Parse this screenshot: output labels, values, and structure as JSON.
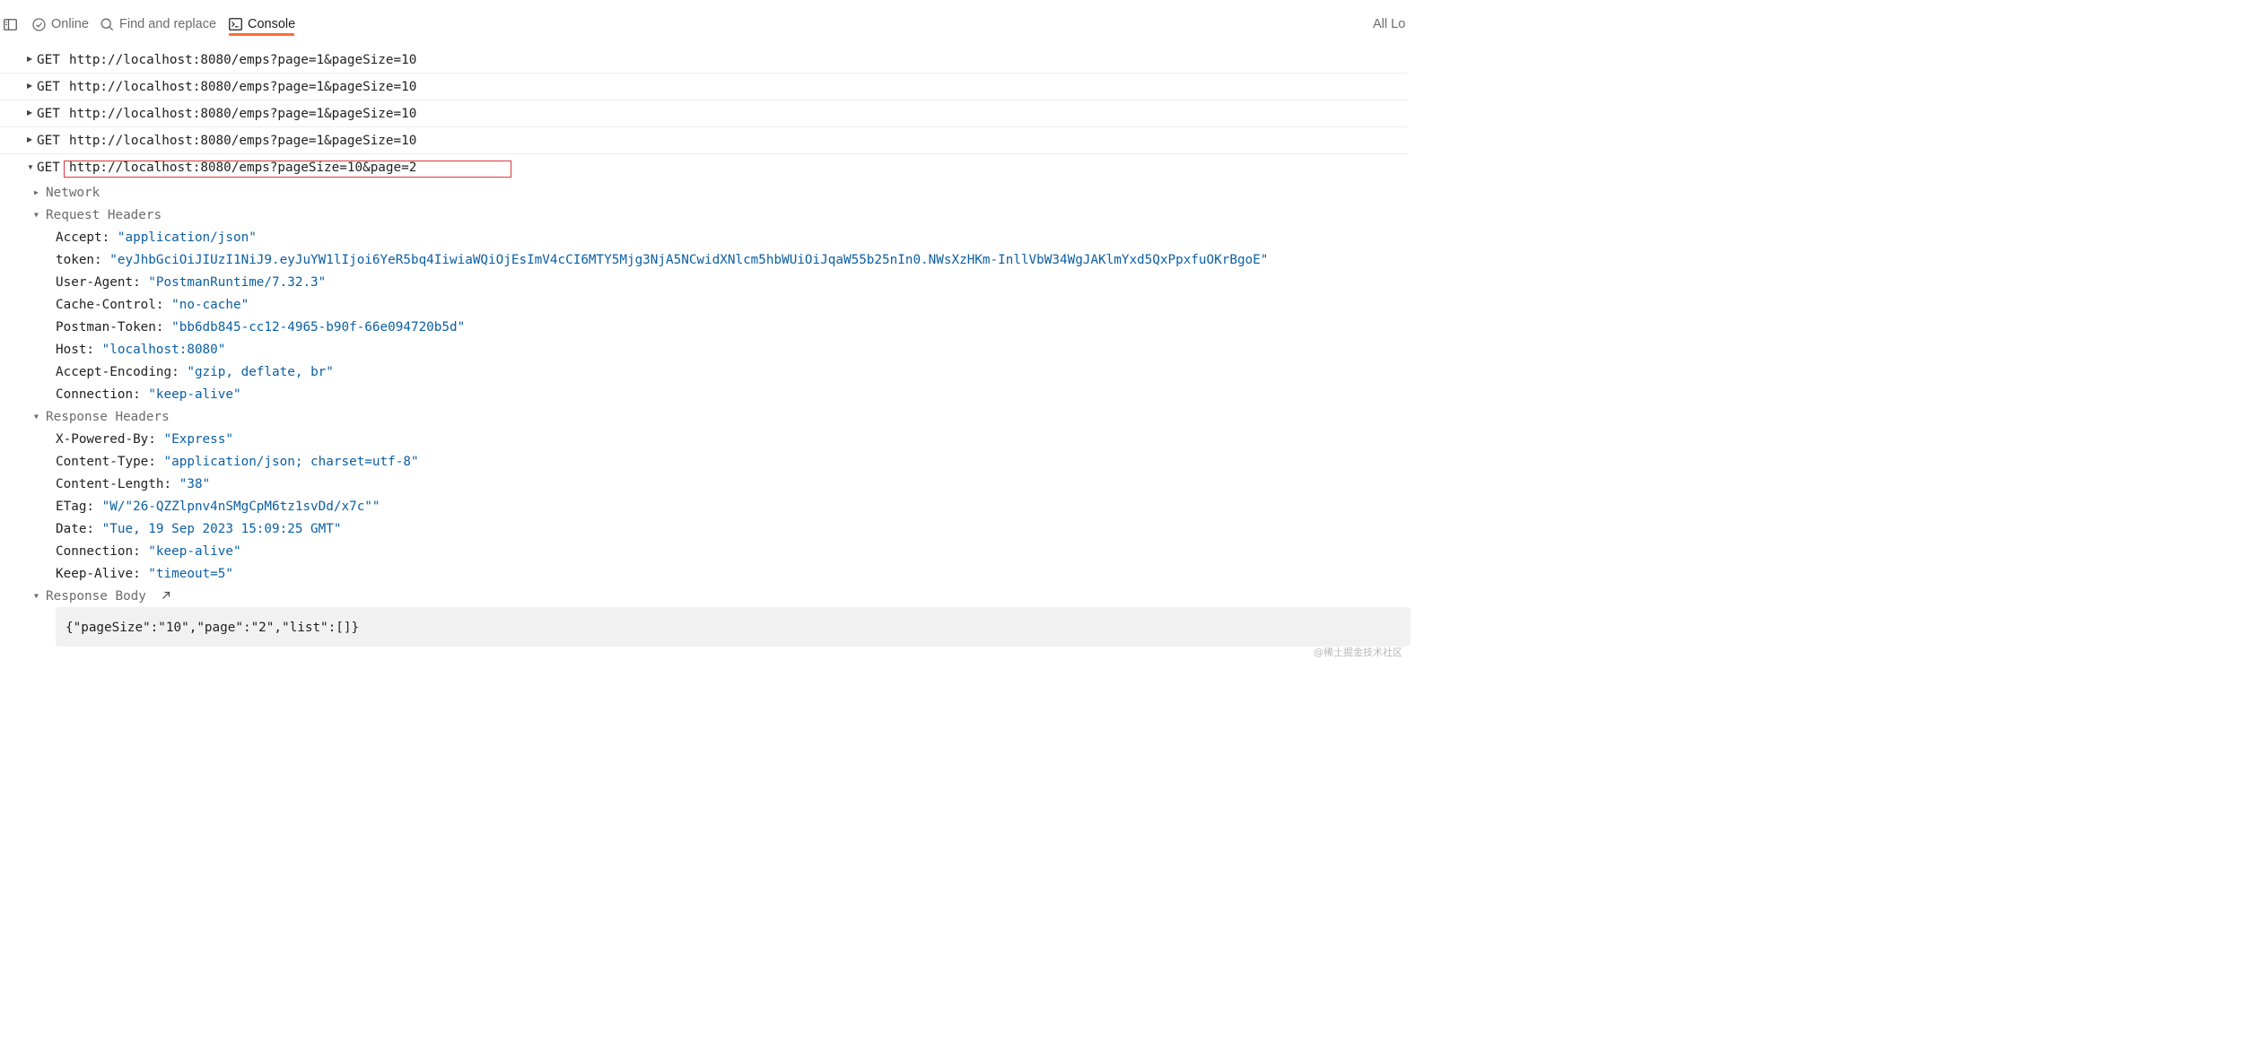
{
  "toolbar": {
    "online_label": "Online",
    "find_label": "Find and replace",
    "console_label": "Console",
    "logs_label": "All Lo"
  },
  "requests": [
    {
      "method": "GET",
      "url": "http://localhost:8080/emps?page=1&pageSize=10"
    },
    {
      "method": "GET",
      "url": "http://localhost:8080/emps?page=1&pageSize=10"
    },
    {
      "method": "GET",
      "url": "http://localhost:8080/emps?page=1&pageSize=10"
    },
    {
      "method": "GET",
      "url": "http://localhost:8080/emps?page=1&pageSize=10"
    }
  ],
  "selected_request": {
    "method": "GET",
    "url": "http://localhost:8080/emps?pageSize=10&page=2",
    "network_label": "Network",
    "request_headers_label": "Request Headers",
    "request_headers": [
      {
        "key": "Accept:",
        "value": "\"application/json\""
      },
      {
        "key": "token:",
        "value": "\"eyJhbGciOiJIUzI1NiJ9.eyJuYW1lIjoi6YeR5bq4IiwiaWQiOjEsImV4cCI6MTY5Mjg3NjA5NCwidXNlcm5hbWUiOiJqaW55b25nIn0.NWsXzHKm-InllVbW34WgJAKlmYxd5QxPpxfuOKrBgoE\""
      },
      {
        "key": "User-Agent:",
        "value": "\"PostmanRuntime/7.32.3\""
      },
      {
        "key": "Cache-Control:",
        "value": "\"no-cache\""
      },
      {
        "key": "Postman-Token:",
        "value": "\"bb6db845-cc12-4965-b90f-66e094720b5d\""
      },
      {
        "key": "Host:",
        "value": "\"localhost:8080\""
      },
      {
        "key": "Accept-Encoding:",
        "value": "\"gzip, deflate, br\""
      },
      {
        "key": "Connection:",
        "value": "\"keep-alive\""
      }
    ],
    "response_headers_label": "Response Headers",
    "response_headers": [
      {
        "key": "X-Powered-By:",
        "value": "\"Express\""
      },
      {
        "key": "Content-Type:",
        "value": "\"application/json; charset=utf-8\""
      },
      {
        "key": "Content-Length:",
        "value": "\"38\""
      },
      {
        "key": "ETag:",
        "value": "\"W/\"26-QZZlpnv4nSMgCpM6tz1svDd/x7c\"\""
      },
      {
        "key": "Date:",
        "value": "\"Tue, 19 Sep 2023 15:09:25 GMT\""
      },
      {
        "key": "Connection:",
        "value": "\"keep-alive\""
      },
      {
        "key": "Keep-Alive:",
        "value": "\"timeout=5\""
      }
    ],
    "response_body_label": "Response Body",
    "response_body": "{\"pageSize\":\"10\",\"page\":\"2\",\"list\":[]}"
  },
  "watermark": "@稀土掘金技术社区",
  "colors": {
    "accent": "#ff6c37",
    "string_value": "#0b5fa5",
    "highlight_box": "#e0353b"
  }
}
